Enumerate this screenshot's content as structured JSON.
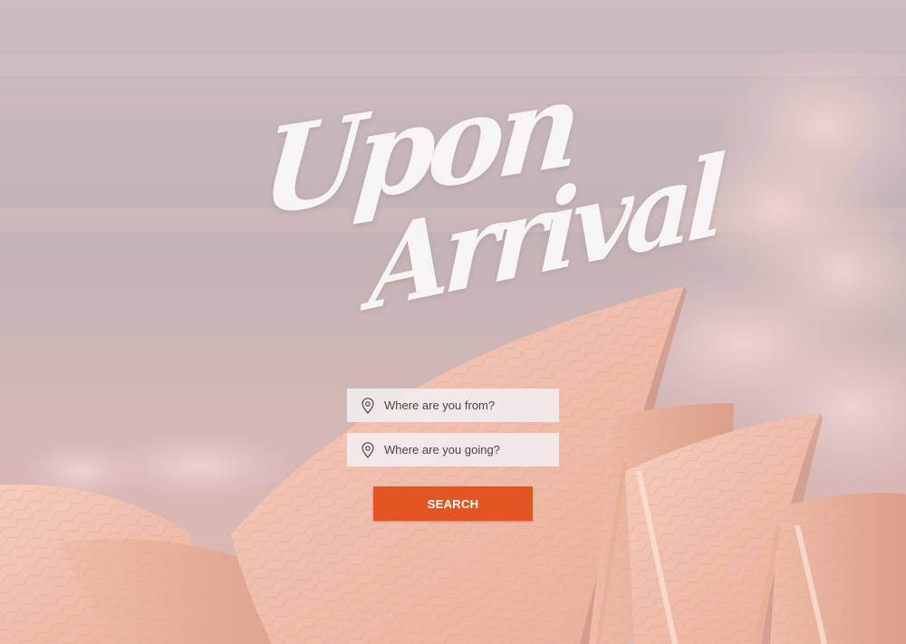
{
  "hero": {
    "title_line1": "Upon",
    "title_line2": "Arrival",
    "background_scene": "opera-house-sails-under-pink-clouds"
  },
  "search": {
    "from_placeholder": "Where are you from?",
    "to_placeholder": "Where are you going?",
    "button_label": "SEARCH",
    "field_icon": "map-pin-icon"
  },
  "colors": {
    "accent": "#e35522",
    "sky": "#c7b2b6",
    "sails": "#f0b9a5",
    "field_bg": "#f1eeee",
    "text_dark": "#4a4443"
  }
}
